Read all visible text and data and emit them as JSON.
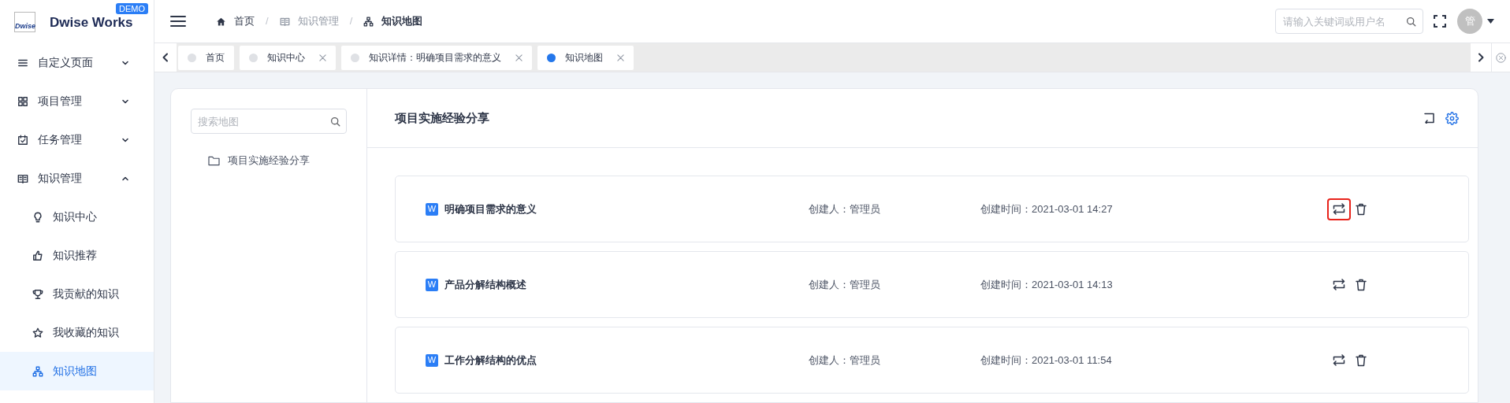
{
  "logo": {
    "mark": "Dwise",
    "name": "Dwise Works",
    "badge": "DEMO"
  },
  "sidebar": {
    "items": [
      {
        "label": "自定义页面",
        "kind": "list",
        "expanded": false,
        "selected": false
      },
      {
        "label": "项目管理",
        "kind": "grid",
        "expanded": false,
        "selected": false
      },
      {
        "label": "任务管理",
        "kind": "calendar",
        "expanded": false,
        "selected": false
      },
      {
        "label": "知识管理",
        "kind": "book",
        "expanded": true,
        "selected": false,
        "children": [
          {
            "label": "知识中心",
            "kind": "bulb",
            "selected": false
          },
          {
            "label": "知识推荐",
            "kind": "thumb",
            "selected": false
          },
          {
            "label": "我贡献的知识",
            "kind": "trophy",
            "selected": false
          },
          {
            "label": "我收藏的知识",
            "kind": "star",
            "selected": false
          },
          {
            "label": "知识地图",
            "kind": "sitemap",
            "selected": true
          }
        ]
      }
    ]
  },
  "breadcrumb": [
    {
      "label": "首页",
      "kind": "home",
      "current": false,
      "muted": false
    },
    {
      "separator": "/",
      "label": "知识管理",
      "kind": "book",
      "current": false,
      "muted": true
    },
    {
      "separator": "/",
      "label": "知识地图",
      "kind": "sitemap",
      "current": true,
      "muted": false
    }
  ],
  "header": {
    "search_placeholder": "请输入关键词或用户名",
    "avatar": "管"
  },
  "tabs": [
    {
      "label": "首页",
      "selected": false,
      "closable": false
    },
    {
      "label": "知识中心",
      "selected": false,
      "closable": true
    },
    {
      "label": "知识详情：明确项目需求的意义",
      "selected": false,
      "closable": true
    },
    {
      "label": "知识地图",
      "selected": true,
      "closable": true
    }
  ],
  "map_panel": {
    "search_placeholder": "搜索地图",
    "tree": [
      {
        "label": "项目实施经验分享"
      }
    ]
  },
  "main": {
    "title": "项目实施经验分享",
    "rows": [
      {
        "badge": "W",
        "title": "明确项目需求的意义",
        "creator": "创建人：管理员",
        "created": "创建时间：2021-03-01 14:27",
        "highlighted": true
      },
      {
        "badge": "W",
        "title": "产品分解结构概述",
        "creator": "创建人：管理员",
        "created": "创建时间：2021-03-01 14:13",
        "highlighted": false
      },
      {
        "badge": "W",
        "title": "工作分解结构的优点",
        "creator": "创建人：管理员",
        "created": "创建时间：2021-03-01 11:54",
        "highlighted": false
      }
    ]
  }
}
